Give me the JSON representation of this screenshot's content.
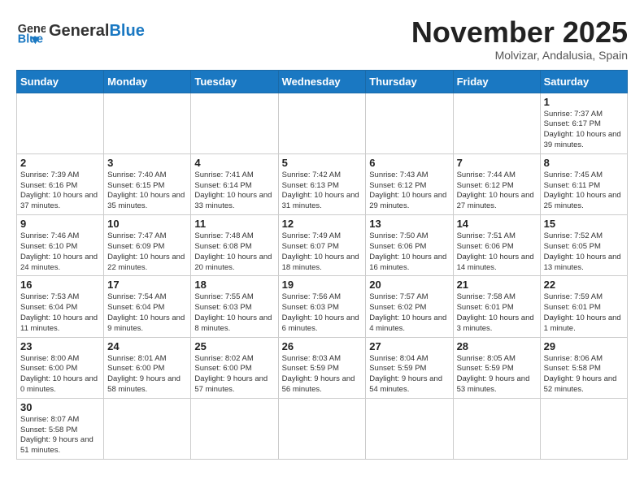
{
  "header": {
    "logo_general": "General",
    "logo_blue": "Blue",
    "month_title": "November 2025",
    "location": "Molvizar, Andalusia, Spain"
  },
  "weekdays": [
    "Sunday",
    "Monday",
    "Tuesday",
    "Wednesday",
    "Thursday",
    "Friday",
    "Saturday"
  ],
  "weeks": [
    [
      {
        "day": "",
        "info": "",
        "empty": true
      },
      {
        "day": "",
        "info": "",
        "empty": true
      },
      {
        "day": "",
        "info": "",
        "empty": true
      },
      {
        "day": "",
        "info": "",
        "empty": true
      },
      {
        "day": "",
        "info": "",
        "empty": true
      },
      {
        "day": "",
        "info": "",
        "empty": true
      },
      {
        "day": "1",
        "info": "Sunrise: 7:37 AM\nSunset: 6:17 PM\nDaylight: 10 hours\nand 39 minutes."
      }
    ],
    [
      {
        "day": "2",
        "info": "Sunrise: 7:39 AM\nSunset: 6:16 PM\nDaylight: 10 hours\nand 37 minutes."
      },
      {
        "day": "3",
        "info": "Sunrise: 7:40 AM\nSunset: 6:15 PM\nDaylight: 10 hours\nand 35 minutes."
      },
      {
        "day": "4",
        "info": "Sunrise: 7:41 AM\nSunset: 6:14 PM\nDaylight: 10 hours\nand 33 minutes."
      },
      {
        "day": "5",
        "info": "Sunrise: 7:42 AM\nSunset: 6:13 PM\nDaylight: 10 hours\nand 31 minutes."
      },
      {
        "day": "6",
        "info": "Sunrise: 7:43 AM\nSunset: 6:12 PM\nDaylight: 10 hours\nand 29 minutes."
      },
      {
        "day": "7",
        "info": "Sunrise: 7:44 AM\nSunset: 6:12 PM\nDaylight: 10 hours\nand 27 minutes."
      },
      {
        "day": "8",
        "info": "Sunrise: 7:45 AM\nSunset: 6:11 PM\nDaylight: 10 hours\nand 25 minutes."
      }
    ],
    [
      {
        "day": "9",
        "info": "Sunrise: 7:46 AM\nSunset: 6:10 PM\nDaylight: 10 hours\nand 24 minutes."
      },
      {
        "day": "10",
        "info": "Sunrise: 7:47 AM\nSunset: 6:09 PM\nDaylight: 10 hours\nand 22 minutes."
      },
      {
        "day": "11",
        "info": "Sunrise: 7:48 AM\nSunset: 6:08 PM\nDaylight: 10 hours\nand 20 minutes."
      },
      {
        "day": "12",
        "info": "Sunrise: 7:49 AM\nSunset: 6:07 PM\nDaylight: 10 hours\nand 18 minutes."
      },
      {
        "day": "13",
        "info": "Sunrise: 7:50 AM\nSunset: 6:06 PM\nDaylight: 10 hours\nand 16 minutes."
      },
      {
        "day": "14",
        "info": "Sunrise: 7:51 AM\nSunset: 6:06 PM\nDaylight: 10 hours\nand 14 minutes."
      },
      {
        "day": "15",
        "info": "Sunrise: 7:52 AM\nSunset: 6:05 PM\nDaylight: 10 hours\nand 13 minutes."
      }
    ],
    [
      {
        "day": "16",
        "info": "Sunrise: 7:53 AM\nSunset: 6:04 PM\nDaylight: 10 hours\nand 11 minutes."
      },
      {
        "day": "17",
        "info": "Sunrise: 7:54 AM\nSunset: 6:04 PM\nDaylight: 10 hours\nand 9 minutes."
      },
      {
        "day": "18",
        "info": "Sunrise: 7:55 AM\nSunset: 6:03 PM\nDaylight: 10 hours\nand 8 minutes."
      },
      {
        "day": "19",
        "info": "Sunrise: 7:56 AM\nSunset: 6:03 PM\nDaylight: 10 hours\nand 6 minutes."
      },
      {
        "day": "20",
        "info": "Sunrise: 7:57 AM\nSunset: 6:02 PM\nDaylight: 10 hours\nand 4 minutes."
      },
      {
        "day": "21",
        "info": "Sunrise: 7:58 AM\nSunset: 6:01 PM\nDaylight: 10 hours\nand 3 minutes."
      },
      {
        "day": "22",
        "info": "Sunrise: 7:59 AM\nSunset: 6:01 PM\nDaylight: 10 hours\nand 1 minute."
      }
    ],
    [
      {
        "day": "23",
        "info": "Sunrise: 8:00 AM\nSunset: 6:00 PM\nDaylight: 10 hours\nand 0 minutes."
      },
      {
        "day": "24",
        "info": "Sunrise: 8:01 AM\nSunset: 6:00 PM\nDaylight: 9 hours\nand 58 minutes."
      },
      {
        "day": "25",
        "info": "Sunrise: 8:02 AM\nSunset: 6:00 PM\nDaylight: 9 hours\nand 57 minutes."
      },
      {
        "day": "26",
        "info": "Sunrise: 8:03 AM\nSunset: 5:59 PM\nDaylight: 9 hours\nand 56 minutes."
      },
      {
        "day": "27",
        "info": "Sunrise: 8:04 AM\nSunset: 5:59 PM\nDaylight: 9 hours\nand 54 minutes."
      },
      {
        "day": "28",
        "info": "Sunrise: 8:05 AM\nSunset: 5:59 PM\nDaylight: 9 hours\nand 53 minutes."
      },
      {
        "day": "29",
        "info": "Sunrise: 8:06 AM\nSunset: 5:58 PM\nDaylight: 9 hours\nand 52 minutes."
      }
    ],
    [
      {
        "day": "30",
        "info": "Sunrise: 8:07 AM\nSunset: 5:58 PM\nDaylight: 9 hours\nand 51 minutes."
      },
      {
        "day": "",
        "info": "",
        "empty": true
      },
      {
        "day": "",
        "info": "",
        "empty": true
      },
      {
        "day": "",
        "info": "",
        "empty": true
      },
      {
        "day": "",
        "info": "",
        "empty": true
      },
      {
        "day": "",
        "info": "",
        "empty": true
      },
      {
        "day": "",
        "info": "",
        "empty": true
      }
    ]
  ]
}
